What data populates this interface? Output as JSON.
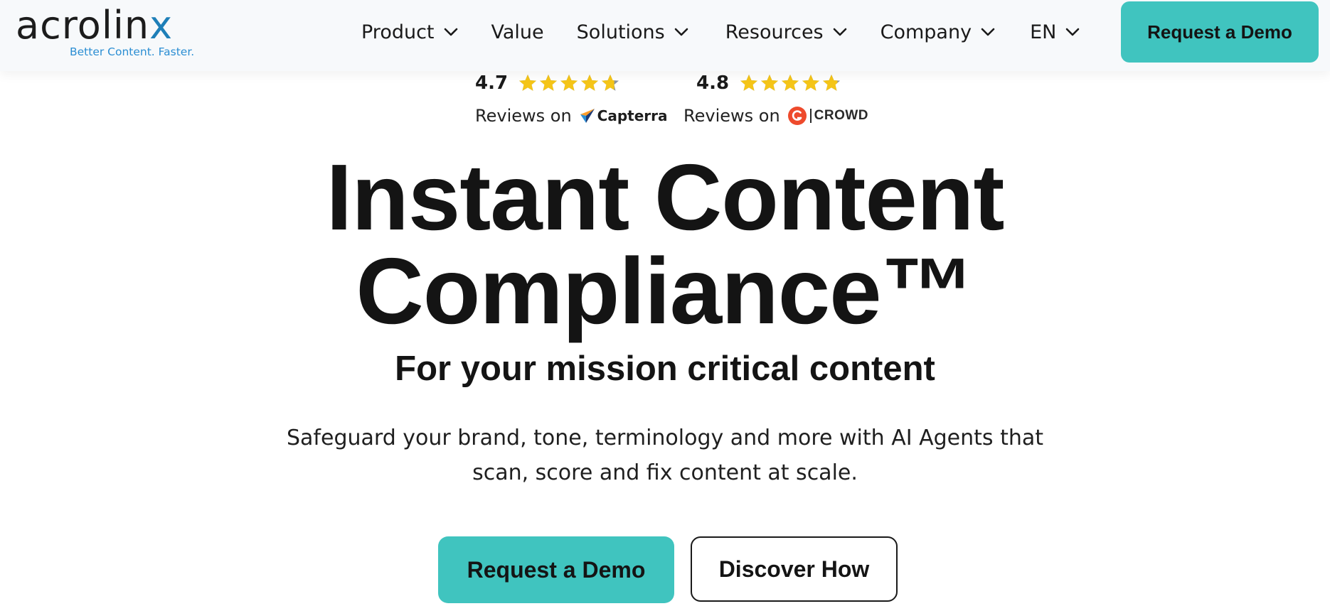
{
  "logo": {
    "wordmark_prefix": "acrolin",
    "wordmark_suffix": "x",
    "tagline": "Better Content. Faster."
  },
  "nav": {
    "items": [
      {
        "label": "Product",
        "has_dropdown": true
      },
      {
        "label": "Value",
        "has_dropdown": false
      },
      {
        "label": "Solutions",
        "has_dropdown": true
      },
      {
        "label": "Resources",
        "has_dropdown": true
      },
      {
        "label": "Company",
        "has_dropdown": true
      },
      {
        "label": "EN",
        "has_dropdown": true
      }
    ],
    "cta_label": "Request a Demo"
  },
  "ratings": [
    {
      "score": "4.7",
      "stars": 4.7,
      "reviews_on": "Reviews on",
      "source": "Capterra"
    },
    {
      "score": "4.8",
      "stars": 4.8,
      "reviews_on": "Reviews on",
      "source": "CROWD"
    }
  ],
  "hero": {
    "title_line1": "Instant Content",
    "title_line2": "Compliance™",
    "subtitle": "For your mission critical content",
    "description_line1": "Safeguard your brand, tone, terminology and more with AI Agents that",
    "description_line2": "scan, score and fix content at scale.",
    "primary_cta": "Request a Demo",
    "secondary_cta": "Discover How"
  },
  "colors": {
    "accent": "#40c4bf",
    "star": "#f5c518",
    "star_empty": "#8a94a3",
    "header_bg": "#f7f9fb",
    "logo_blue": "#2b8ed3",
    "g2_red": "#ee4a2c"
  }
}
